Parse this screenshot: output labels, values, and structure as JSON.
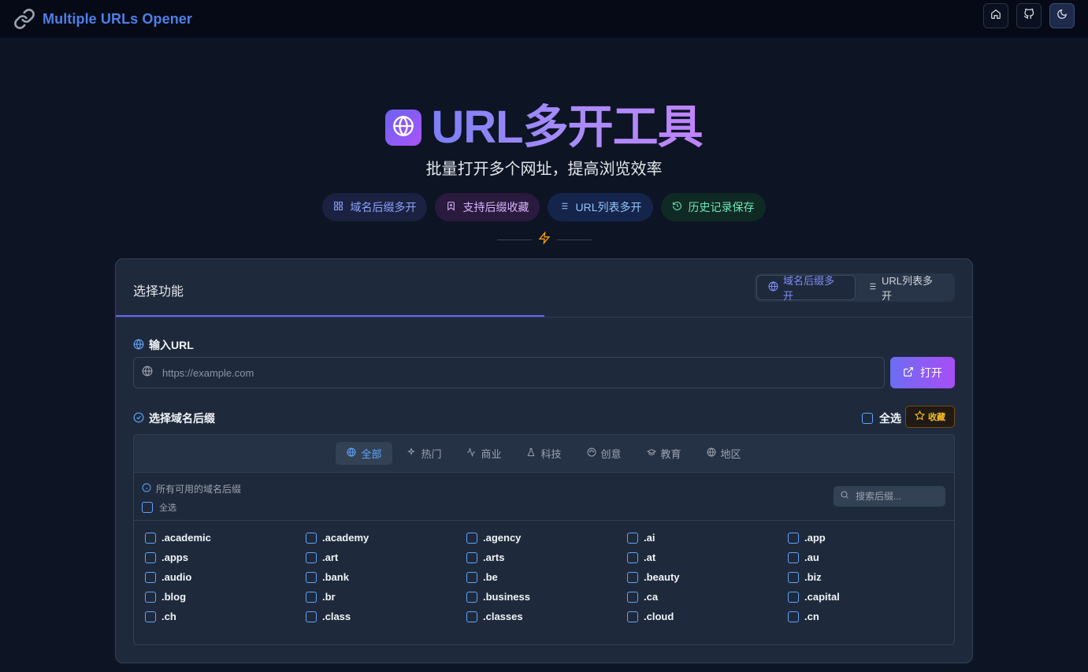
{
  "app": {
    "title": "Multiple URLs Opener"
  },
  "nav": {
    "icons": [
      "home-icon",
      "github-icon",
      "moon-icon"
    ]
  },
  "hero": {
    "title": "URL多开工具",
    "subtitle": "批量打开多个网址，提高浏览效率",
    "pills": [
      {
        "label": "域名后缀多开",
        "icon": "grid-icon"
      },
      {
        "label": "支持后缀收藏",
        "icon": "bookmark-icon"
      },
      {
        "label": "URL列表多开",
        "icon": "list-icon"
      },
      {
        "label": "历史记录保存",
        "icon": "history-icon"
      }
    ]
  },
  "card": {
    "title": "选择功能",
    "tabs": [
      {
        "label": "域名后缀多开",
        "active": true
      },
      {
        "label": "URL列表多开",
        "active": false
      }
    ],
    "url_label": "输入URL",
    "url_placeholder": "https://example.com",
    "url_value": "",
    "open_label": "打开",
    "suffix_label": "选择域名后缀",
    "select_all_label": "全选",
    "favorite_label": "收藏",
    "categories": [
      {
        "label": "全部",
        "active": true
      },
      {
        "label": "热门",
        "active": false
      },
      {
        "label": "商业",
        "active": false
      },
      {
        "label": "科技",
        "active": false
      },
      {
        "label": "创意",
        "active": false
      },
      {
        "label": "教育",
        "active": false
      },
      {
        "label": "地区",
        "active": false
      }
    ],
    "info_text": "所有可用的域名后缀",
    "sub_select_all": "全选",
    "search_placeholder": "搜索后缀...",
    "suffixes": [
      ".academic",
      ".academy",
      ".agency",
      ".ai",
      ".app",
      ".apps",
      ".art",
      ".arts",
      ".at",
      ".au",
      ".audio",
      ".bank",
      ".be",
      ".beauty",
      ".biz",
      ".blog",
      ".br",
      ".business",
      ".ca",
      ".capital",
      ".ch",
      ".class",
      ".classes",
      ".cloud",
      ".cn"
    ]
  },
  "colors": {
    "accent": "#6366f1",
    "brand": "#4f7fe8",
    "background": "#0d1424",
    "card": "#1e293b"
  }
}
